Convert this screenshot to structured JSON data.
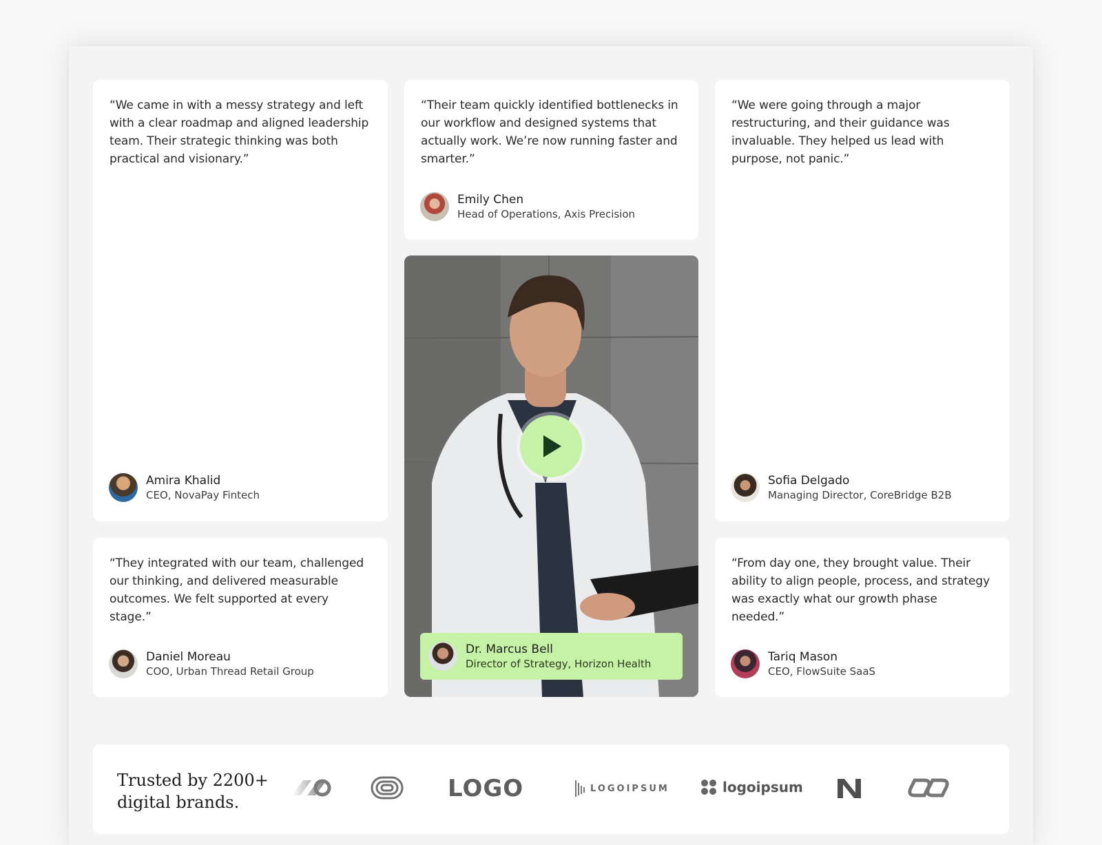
{
  "testimonials": [
    {
      "quote": "“We came in with a messy strategy and left with a clear roadmap and aligned leadership team. Their strategic thinking was both practical and visionary.”",
      "name": "Amira Khalid",
      "role": "CEO, NovaPay Fintech"
    },
    {
      "quote": "“Their team quickly identified bottlenecks in our workflow and designed systems that actually work. We’re now running faster and smarter.”",
      "name": "Emily Chen",
      "role": "Head of Operations, Axis Precision"
    },
    {
      "quote": "“We were going through a major restructuring, and their guidance was invaluable. They helped us lead with purpose, not panic.”",
      "name": "Sofia Delgado",
      "role": "Managing Director, CoreBridge B2B"
    },
    {
      "quote": "“They integrated with our team, challenged our thinking, and delivered measurable outcomes. We felt supported at every stage.”",
      "name": "Daniel Moreau",
      "role": "COO, Urban Thread Retail Group"
    },
    {
      "quote": "“From day one, they brought value. Their ability to align people, process, and strategy was exactly what our growth phase needed.”",
      "name": "Tariq Mason",
      "role": "CEO, FlowSuite SaaS"
    }
  ],
  "video": {
    "name": "Dr. Marcus Bell",
    "role": "Director of Strategy, Horizon Health",
    "play_icon": "play-icon"
  },
  "brands": {
    "trusted_line1": "Trusted by 2200+",
    "trusted_line2": "digital brands.",
    "logos": [
      "LOGO",
      "LOGOIPSUM",
      "logoipsum"
    ]
  },
  "colors": {
    "accent": "#c6f2a7",
    "play_glyph": "#173a1c"
  }
}
